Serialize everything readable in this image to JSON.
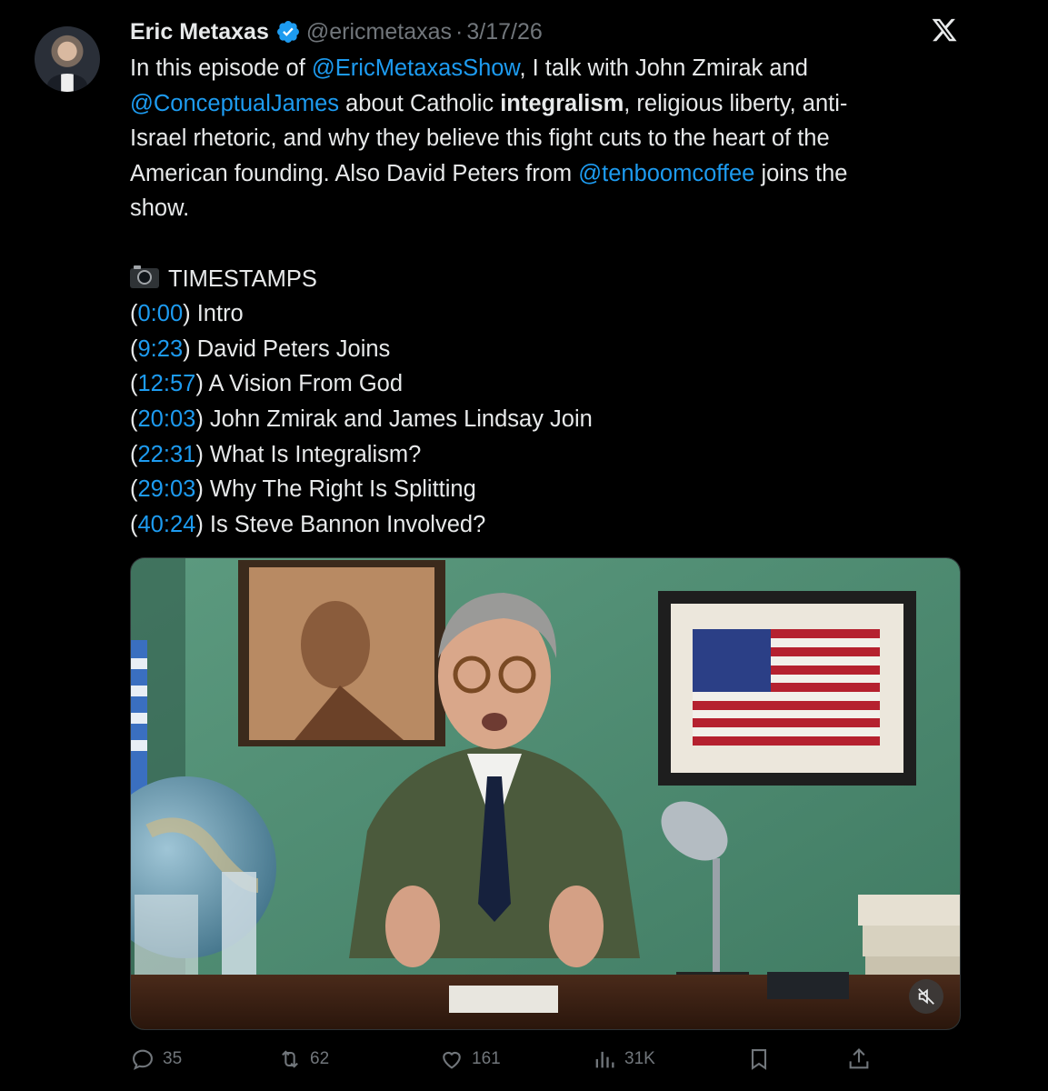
{
  "author": {
    "name": "Eric Metaxas",
    "handle": "@ericmetaxas",
    "separator": "·",
    "date": "3/17/26"
  },
  "tweet": {
    "line1_pre": "In this episode of ",
    "mention1": "@EricMetaxasShow",
    "line1_post": ", I talk with John Zmirak and",
    "mention2": "@ConceptualJames",
    "line2_mid": " about Catholic ",
    "bold_word": "integralism",
    "line2_post": ", religious liberty, anti-",
    "line3": "Israel rhetoric, and why they believe this fight cuts to the heart of the",
    "line4_pre": "American founding. Also David Peters from ",
    "mention3": "@tenboomcoffee",
    "line4_post": " joins the",
    "line5": "show.",
    "timestamps_heading": "TIMESTAMPS",
    "timestamps": [
      {
        "time": "0:00",
        "label": "Intro"
      },
      {
        "time": "9:23",
        "label": "David Peters Joins"
      },
      {
        "time": "12:57",
        "label": "A Vision From God"
      },
      {
        "time": "20:03",
        "label": "John Zmirak and James Lindsay Join"
      },
      {
        "time": "22:31",
        "label": "What Is Integralism?"
      },
      {
        "time": "29:03",
        "label": "Why The Right Is Splitting"
      },
      {
        "time": "40:24",
        "label": "Is Steve Bannon Involved?"
      }
    ]
  },
  "actions": {
    "replies": "35",
    "reposts": "62",
    "likes": "161",
    "views": "31K"
  },
  "colors": {
    "background": "#000000",
    "text": "#e7e9ea",
    "muted": "#71767b",
    "link": "#1d9bf0",
    "verified": "#1d9bf0"
  },
  "icons": [
    "verified-badge-icon",
    "x-logo-icon",
    "camera-icon",
    "mute-icon",
    "reply-icon",
    "repost-icon",
    "like-icon",
    "views-icon",
    "bookmark-icon",
    "share-icon"
  ]
}
